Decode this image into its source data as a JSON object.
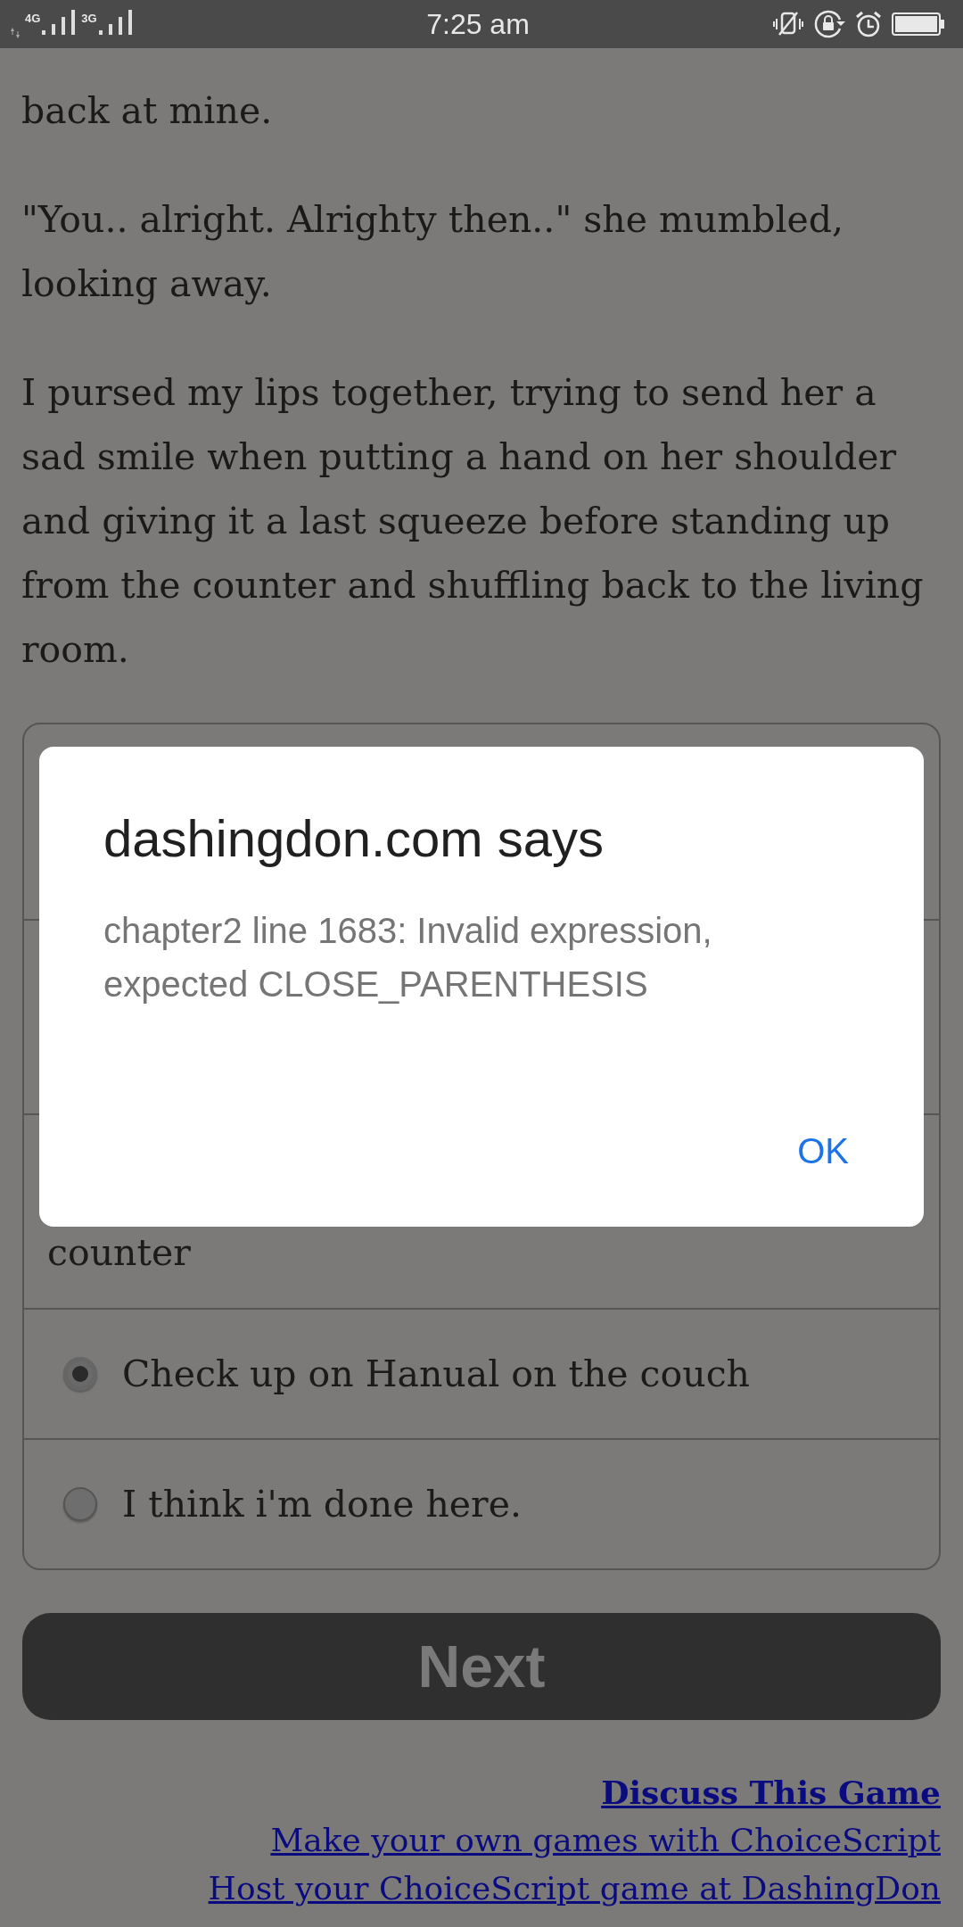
{
  "status_bar": {
    "time": "7:25 am",
    "networks": [
      "4G",
      "3G"
    ]
  },
  "paragraphs": [
    "back at mine.",
    "\"You.. alright. Alrighty then..\" she mumbled, looking away.",
    "I pursed my lips together, trying to send her a sad smile when putting a hand on her shoulder and giving it a last squeeze before standing up from the counter and shuffling back to the living room."
  ],
  "choices": [
    {
      "kind": "covered",
      "text": "counter"
    },
    {
      "kind": "radio",
      "text": "Check up on Hanual on the couch",
      "selected": true
    },
    {
      "kind": "radio",
      "text": "I think i'm done here.",
      "selected": false
    }
  ],
  "next_button": {
    "label": "Next"
  },
  "links": [
    {
      "text": "Discuss This Game",
      "kind": "bold"
    },
    {
      "text": "Make your own games with ChoiceScript",
      "kind": "plain"
    },
    {
      "text": "Host your ChoiceScript game at DashingDon",
      "kind": "plain"
    }
  ],
  "dialog": {
    "title": "dashingdon.com says",
    "message": "chapter2 line 1683: Invalid expression, expected CLOSE_PARENTHESIS",
    "button": "OK"
  }
}
